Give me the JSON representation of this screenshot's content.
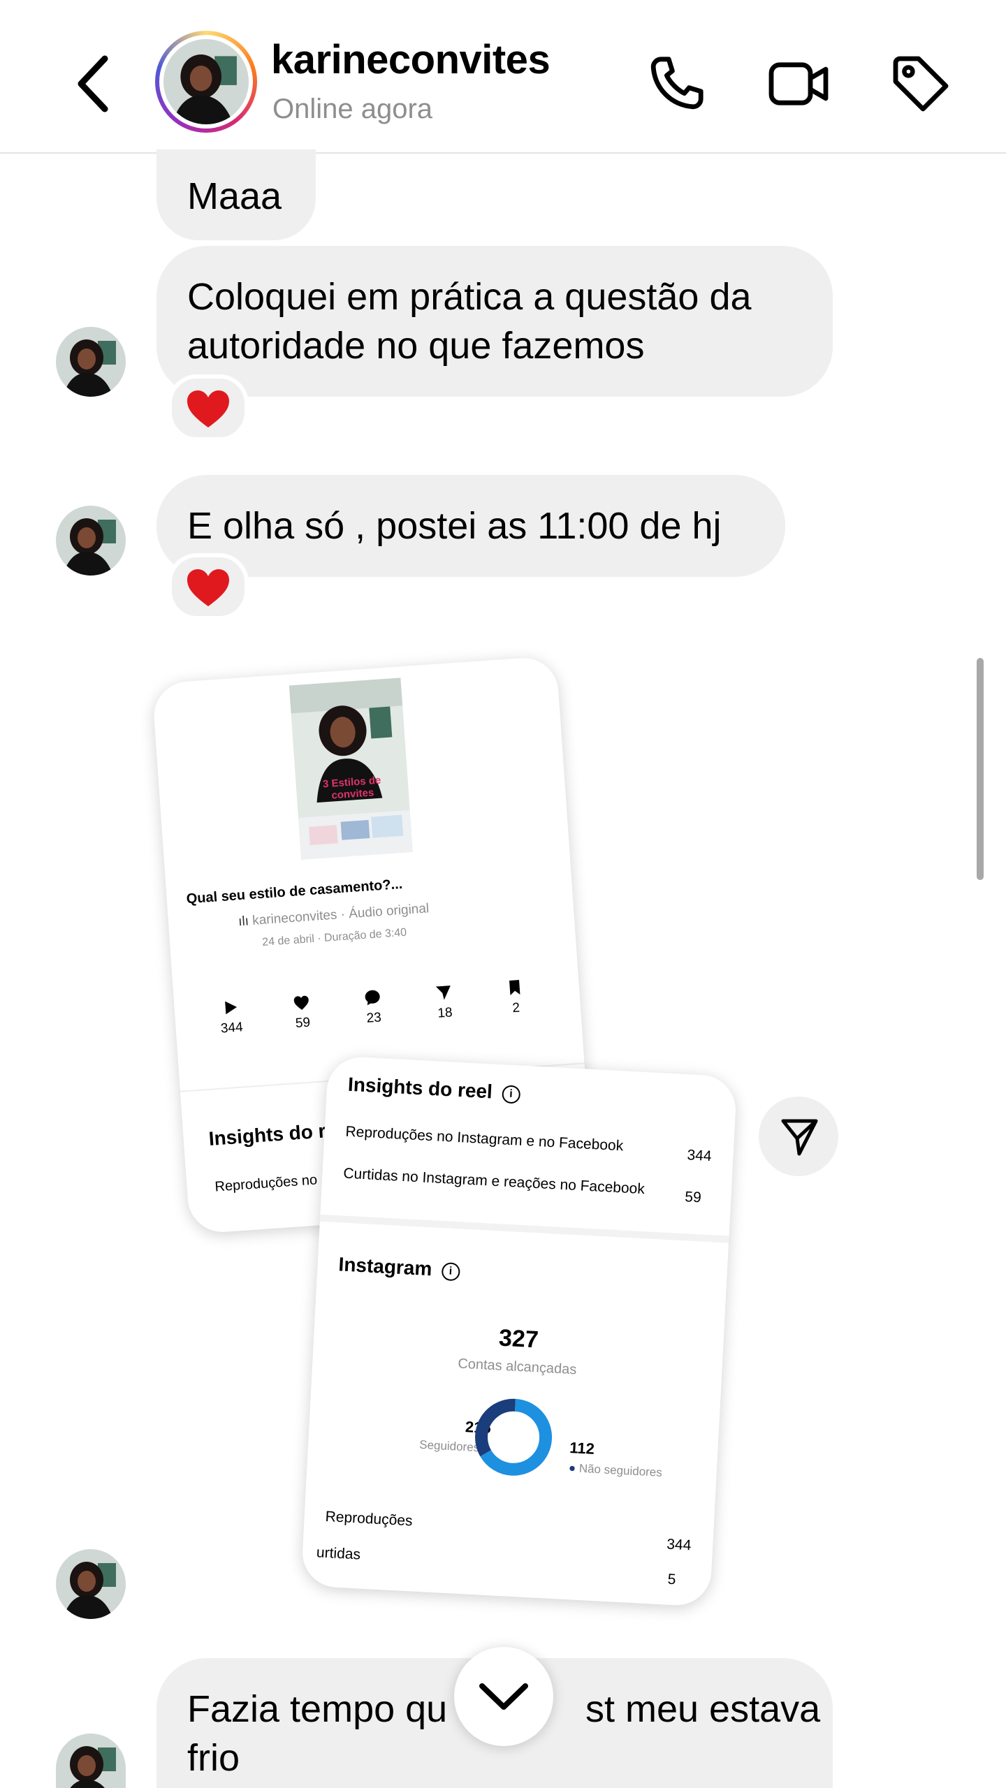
{
  "header": {
    "contact_name": "karineconvites",
    "status": "Online agora",
    "icons": [
      "back-chevron-icon",
      "phone-icon",
      "video-camera-icon",
      "tag-icon"
    ]
  },
  "messages": [
    {
      "text": "Maaa"
    },
    {
      "text_line1": "Coloquei em prática a questão da",
      "text_line2": "autoridade no que fazemos",
      "reaction": "❤️"
    },
    {
      "text": "E olha só , postei as 11:00 de hj",
      "reaction": "❤️"
    },
    {
      "text_line1": "Fazia tempo qu",
      "text_line1b": "st meu estava",
      "text_line2": "frio"
    }
  ],
  "shared_post": {
    "reel_card": {
      "thumb_title_line1": "3 Estilos de",
      "thumb_title_line2": "convites",
      "caption": "Qual seu estilo de casamento?...",
      "audio": "karineconvites · Áudio original",
      "date": "24 de abril · Duração de 3:40",
      "stats": [
        {
          "icon": "play-icon",
          "value": "344"
        },
        {
          "icon": "heart-icon",
          "value": "59"
        },
        {
          "icon": "comment-icon",
          "value": "23"
        },
        {
          "icon": "send-icon",
          "value": "18"
        },
        {
          "icon": "bookmark-icon",
          "value": "2"
        }
      ],
      "insights_partial": "Insights do r",
      "row_partial": "Reproduções no"
    },
    "insights_card": {
      "title": "Insights do reel",
      "rows": [
        {
          "label": "Reproduções no Instagram e no Facebook",
          "value": "344"
        },
        {
          "label": "Curtidas no Instagram e reações no Facebook",
          "value": "59"
        }
      ],
      "instagram_title": "Instagram",
      "reached_value": "327",
      "reached_label": "Contas alcançadas",
      "followers_value": "215",
      "followers_label": "Seguidores",
      "non_followers_value": "112",
      "non_followers_label": "Não seguidores",
      "repro_label": "Reproduções",
      "repro_value": "344",
      "curtidas_partial": "urtidas",
      "curtidas_value_partial": "5",
      "colors": {
        "followers": "#1e90e0",
        "non_followers": "#1a3d7c"
      }
    }
  }
}
